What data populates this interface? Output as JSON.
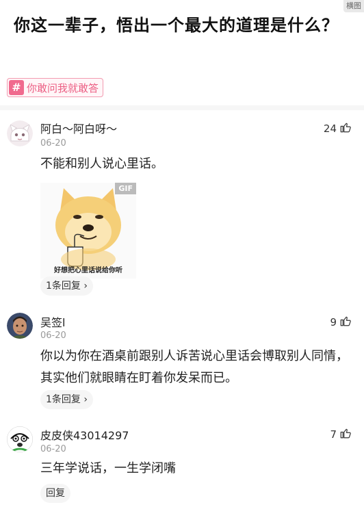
{
  "corner_tag": "横图",
  "question": {
    "title": "你这一辈子，悟出一个最大的道理是什么？",
    "topic_icon": "hash-icon",
    "topic_label": "你敢问我就敢答"
  },
  "colors": {
    "topic_accent": "#f06a8e",
    "meta_gray": "#999999"
  },
  "comments": [
    {
      "username": "阿白～阿白呀～",
      "date": "06-20",
      "likes": "24",
      "text": "不能和别人说心里话。",
      "image": {
        "badge": "GIF",
        "caption": "好想把心里话说给你听"
      },
      "reply_label": "1条回复",
      "reply_chevron": "›"
    },
    {
      "username": "吴签l",
      "date": "06-20",
      "likes": "9",
      "text": "你以为你在酒桌前跟别人诉苦说心里话会博取别人同情，其实他们就眼睛在盯着你发呆而已。",
      "reply_label": "1条回复",
      "reply_chevron": "›"
    },
    {
      "username": "皮皮侠43014297",
      "date": "06-20",
      "likes": "7",
      "text": "三年学说话，一生学闭嘴",
      "reply_label": "回复"
    }
  ]
}
